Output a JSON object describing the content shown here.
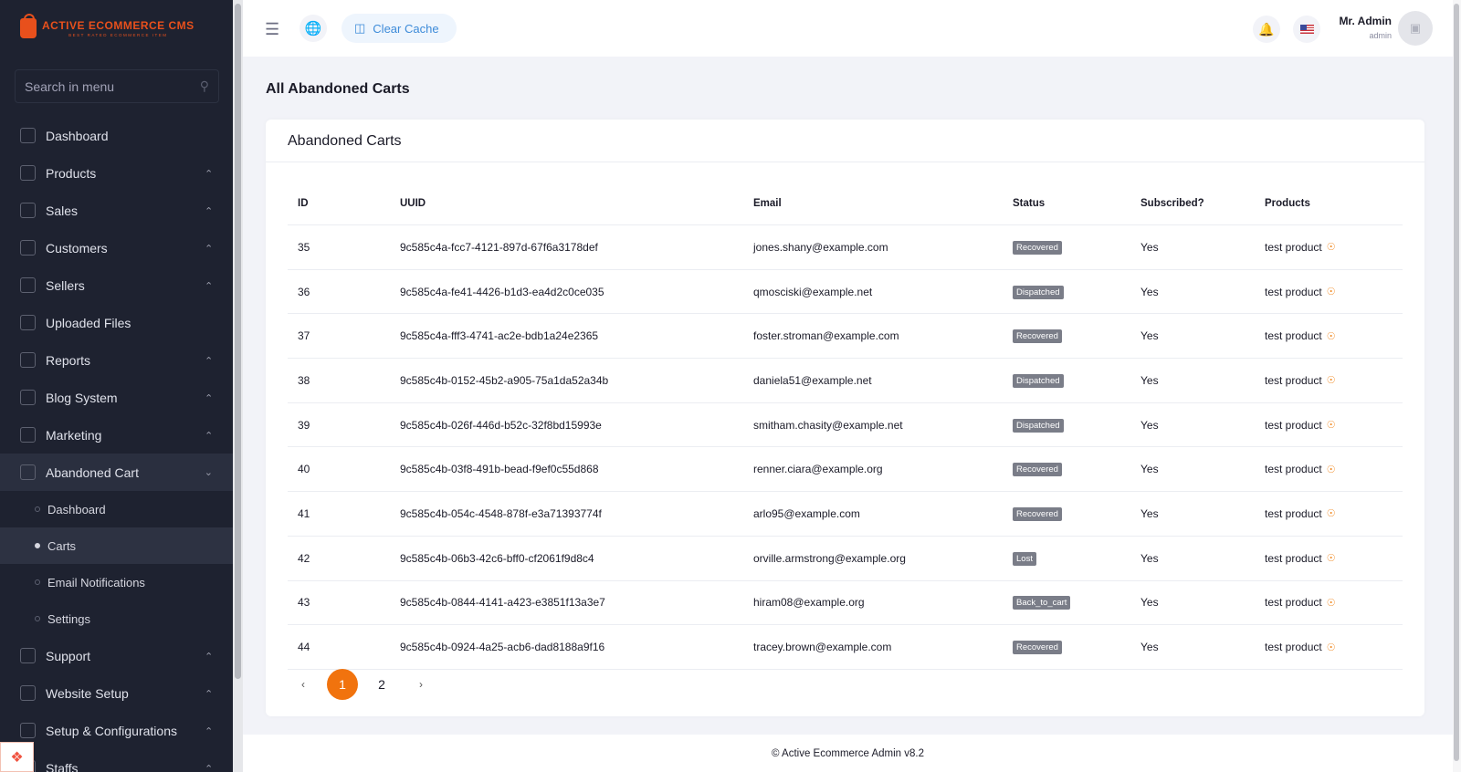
{
  "brand": {
    "name": "ACTIVE ECOMMERCE CMS",
    "tagline": "BEST RATED ECOMMERCE ITEM"
  },
  "sidebar": {
    "search_placeholder": "Search in menu",
    "items": [
      {
        "label": "Dashboard",
        "icon": "dashboard-icon"
      },
      {
        "label": "Products",
        "icon": "box-icon"
      },
      {
        "label": "Sales",
        "icon": "chart-bar-icon"
      },
      {
        "label": "Customers",
        "icon": "users-icon"
      },
      {
        "label": "Sellers",
        "icon": "store-icon"
      },
      {
        "label": "Uploaded Files",
        "icon": "upload-icon"
      },
      {
        "label": "Reports",
        "icon": "report-icon"
      },
      {
        "label": "Blog System",
        "icon": "blog-icon"
      },
      {
        "label": "Marketing",
        "icon": "megaphone-icon"
      },
      {
        "label": "Abandoned Cart",
        "icon": "cart-icon"
      },
      {
        "label": "Support",
        "icon": "support-icon"
      },
      {
        "label": "Website Setup",
        "icon": "website-icon"
      },
      {
        "label": "Setup & Configurations",
        "icon": "gear-icon"
      },
      {
        "label": "Staffs",
        "icon": "staff-icon"
      }
    ],
    "abandoned_sub": [
      "Dashboard",
      "Carts",
      "Email Notifications",
      "Settings"
    ]
  },
  "topbar": {
    "clear_cache": "Clear Cache",
    "user_name": "Mr. Admin",
    "user_role": "admin"
  },
  "main": {
    "page_title": "All Abandoned Carts",
    "card_title": "Abandoned Carts",
    "columns": [
      "ID",
      "UUID",
      "Email",
      "Status",
      "Subscribed?",
      "Products"
    ],
    "rows": [
      {
        "id": "35",
        "uuid": "9c585c4a-fcc7-4121-897d-67f6a3178def",
        "email": "jones.shany@example.com",
        "status": "Recovered",
        "subscribed": "Yes",
        "product": "test product"
      },
      {
        "id": "36",
        "uuid": "9c585c4a-fe41-4426-b1d3-ea4d2c0ce035",
        "email": "qmosciski@example.net",
        "status": "Dispatched",
        "subscribed": "Yes",
        "product": "test product"
      },
      {
        "id": "37",
        "uuid": "9c585c4a-fff3-4741-ac2e-bdb1a24e2365",
        "email": "foster.stroman@example.com",
        "status": "Recovered",
        "subscribed": "Yes",
        "product": "test product"
      },
      {
        "id": "38",
        "uuid": "9c585c4b-0152-45b2-a905-75a1da52a34b",
        "email": "daniela51@example.net",
        "status": "Dispatched",
        "subscribed": "Yes",
        "product": "test product"
      },
      {
        "id": "39",
        "uuid": "9c585c4b-026f-446d-b52c-32f8bd15993e",
        "email": "smitham.chasity@example.net",
        "status": "Dispatched",
        "subscribed": "Yes",
        "product": "test product"
      },
      {
        "id": "40",
        "uuid": "9c585c4b-03f8-491b-bead-f9ef0c55d868",
        "email": "renner.ciara@example.org",
        "status": "Recovered",
        "subscribed": "Yes",
        "product": "test product"
      },
      {
        "id": "41",
        "uuid": "9c585c4b-054c-4548-878f-e3a71393774f",
        "email": "arlo95@example.com",
        "status": "Recovered",
        "subscribed": "Yes",
        "product": "test product"
      },
      {
        "id": "42",
        "uuid": "9c585c4b-06b3-42c6-bff0-cf2061f9d8c4",
        "email": "orville.armstrong@example.org",
        "status": "Lost",
        "subscribed": "Yes",
        "product": "test product"
      },
      {
        "id": "43",
        "uuid": "9c585c4b-0844-4141-a423-e3851f13a3e7",
        "email": "hiram08@example.org",
        "status": "Back_to_cart",
        "subscribed": "Yes",
        "product": "test product"
      },
      {
        "id": "44",
        "uuid": "9c585c4b-0924-4a25-acb6-dad8188a9f16",
        "email": "tracey.brown@example.com",
        "status": "Recovered",
        "subscribed": "Yes",
        "product": "test product"
      }
    ],
    "pagination": {
      "prev": "‹",
      "next": "›",
      "pages": [
        "1",
        "2"
      ],
      "current": "1"
    }
  },
  "footer": {
    "text": "© Active Ecommerce Admin v8.2"
  },
  "colors": {
    "accent": "#f1730e",
    "sidebar_bg": "#1e2230",
    "badge": "#7a7d88"
  }
}
